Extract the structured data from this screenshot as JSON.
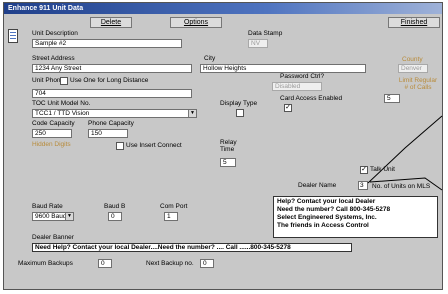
{
  "window": {
    "title": "Enhance 911 Unit Data"
  },
  "toolbar": {
    "delete": "Delete",
    "options": "Options",
    "finished": "Finished"
  },
  "unit_description": {
    "label": "Unit Description",
    "value": "Sample #2"
  },
  "date_stamp": {
    "label": "Data Stamp",
    "value": "NV"
  },
  "street_address": {
    "label": "Street Address",
    "value": "1234 Any Street"
  },
  "city": {
    "label": "City",
    "value": "Hollow Heights"
  },
  "county": {
    "label": "County",
    "value": "Denver"
  },
  "unit_phone": {
    "label": "Unit Phone",
    "long_distance_label": "Use One for Long Distance",
    "value": "704"
  },
  "password_flag": {
    "label": "Password Ctrl?",
    "value": "Disabled"
  },
  "limit_per_unit": {
    "label": "Limit Regular # of Calls",
    "value": "5"
  },
  "model_no": {
    "label": "TOC Unit Model No.",
    "value": "TCC1 / TTD Vision"
  },
  "display_type": {
    "label": "Display Type"
  },
  "card_access": {
    "label": "Card Access Enabled",
    "checked": "✓"
  },
  "code_capacity": {
    "label": "Code Capacity",
    "value": "250",
    "status": "Hidden Digits"
  },
  "phone_capacity": {
    "label": "Phone Capacity",
    "value": "150",
    "insert_connect_label": "Use Insert Connect"
  },
  "relay_time": {
    "label": "Relay Time",
    "value": "5"
  },
  "talk_unit": {
    "label": "Talk Unit",
    "checked": "✓"
  },
  "dealer_info": {
    "label": "Dealer Name",
    "num_units_label": "No. of Units on MLS",
    "num_units": "3"
  },
  "note_lines": [
    "Help? Contact your local Dealer",
    "Need the number? Call 800-345-5278",
    "Select Engineered Systems, Inc.",
    "The friends in Access Control"
  ],
  "baud_rate": {
    "label": "Baud Rate",
    "value": "9600 Baud"
  },
  "baud_b": {
    "label": "Baud B",
    "value": "0"
  },
  "com_port": {
    "label": "Com Port",
    "value": "1"
  },
  "dealer_banner": {
    "label": "Dealer Banner",
    "value": "Need Help? Contact your local Dealer....Need the number? .... Call ......800-345-5278"
  },
  "maximum_backups": {
    "label": "Maximum Backups",
    "value": "0"
  },
  "next_backup": {
    "label": "Next Backup no.",
    "value": "0"
  }
}
